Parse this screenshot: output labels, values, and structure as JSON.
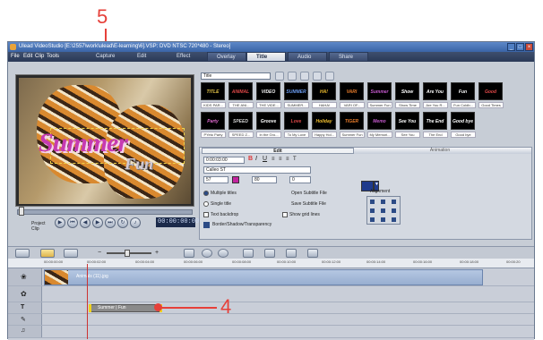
{
  "window": {
    "title": "Ulead VideoStudio [E:\\2557\\work\\ulead\\E-learning\\6].VSP: DVD NTSC 720*480 - Stereo]"
  },
  "menu": [
    "File",
    "Edit",
    "Clip",
    "Tools"
  ],
  "step_tabs": [
    "Capture",
    "Edit",
    "Effect",
    "Overlay",
    "Title",
    "Audio",
    "Share"
  ],
  "active_tab": "Title",
  "callouts": {
    "top": "5",
    "bottom": "4"
  },
  "preview": {
    "title_text": "Summer",
    "sub_text": "Fun",
    "project_label": "Project",
    "clip_label": "Clip",
    "timecode": "00:00:00:00"
  },
  "library": {
    "category": "Title",
    "thumbs": [
      {
        "label": "KIDS PAR..."
      },
      {
        "label": "THE ANI..."
      },
      {
        "label": "THE VIDE..."
      },
      {
        "label": "SUMMER..."
      },
      {
        "label": "HAHA!"
      },
      {
        "label": "VARI OF..."
      },
      {
        "label": "Summer Fun"
      },
      {
        "label": "Show Time"
      },
      {
        "label": "Are You R..."
      },
      {
        "label": "Fun Coldb..."
      },
      {
        "label": "Good Times"
      },
      {
        "label": "PYeto Party"
      },
      {
        "label": "SPEED Z..."
      },
      {
        "label": "In the Gro..."
      },
      {
        "label": "To My Love"
      },
      {
        "label": "Happy Hol..."
      },
      {
        "label": "Summer Fun"
      },
      {
        "label": "My Memori..."
      },
      {
        "label": "See You"
      },
      {
        "label": "The End"
      },
      {
        "label": "Good bye"
      }
    ]
  },
  "edit_panel": {
    "edit_tab": "Edit",
    "anim_tab": "Animation",
    "timecode": "0:00:03:00",
    "font": "Calleo ST",
    "size": "57",
    "line_spacing": "80",
    "angle": "0",
    "options": {
      "multiple": "Multiple titles",
      "single": "Single title",
      "backdrop": "Text backdrop",
      "open_sub": "Open Subtitle File",
      "save_sub": "Save Subtitle File",
      "grid": "Show grid lines",
      "border": "Border/Shadow/Transparency"
    },
    "alignment": "Alignment",
    "color": "#1f3a8c"
  },
  "ruler": [
    "00:00:00:00",
    "00:00:02:00",
    "00:00:04:00",
    "00:00:06:00",
    "00:00:08:00",
    "00:00:10:00",
    "00:00:12:00",
    "00:00:14:00",
    "00:00:16:00",
    "00:00:18:00",
    "00:00:20"
  ],
  "timeline": {
    "video_clip": "Animals (11).jpg",
    "title_clip": "Summer | Fun"
  }
}
